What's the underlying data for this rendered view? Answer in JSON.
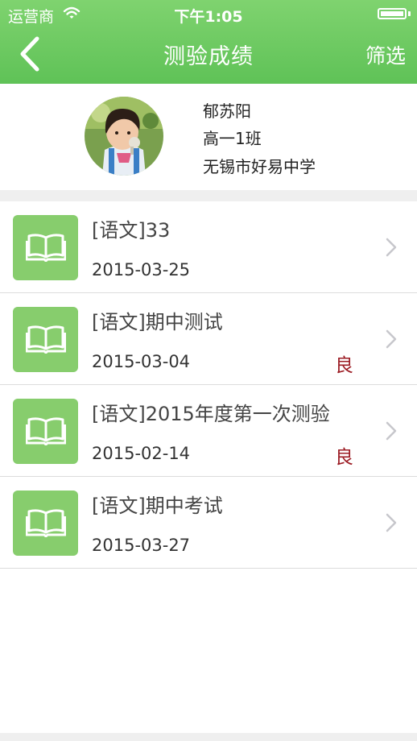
{
  "status_bar": {
    "carrier": "运营商",
    "time": "下午1:05"
  },
  "nav": {
    "title": "测验成绩",
    "filter_label": "筛选"
  },
  "profile": {
    "name": "郁苏阳",
    "class_name": "高一1班",
    "school": "无锡市好易中学"
  },
  "exams": [
    {
      "title": "[语文]33",
      "date": "2015-03-25",
      "grade": ""
    },
    {
      "title": "[语文]期中测试",
      "date": "2015-03-04",
      "grade": "良"
    },
    {
      "title": "[语文]2015年度第一次测验",
      "date": "2015-02-14",
      "grade": "良"
    },
    {
      "title": "[语文]期中考试",
      "date": "2015-03-27",
      "grade": ""
    }
  ],
  "colors": {
    "nav_green": "#6bc95c",
    "icon_green": "#87cd6d",
    "grade_red": "#9c1c24"
  },
  "icons": {
    "back": "chevron-left-icon",
    "book": "open-book-icon",
    "row_arrow": "chevron-right-icon",
    "wifi": "wifi-icon",
    "battery": "battery-icon"
  }
}
